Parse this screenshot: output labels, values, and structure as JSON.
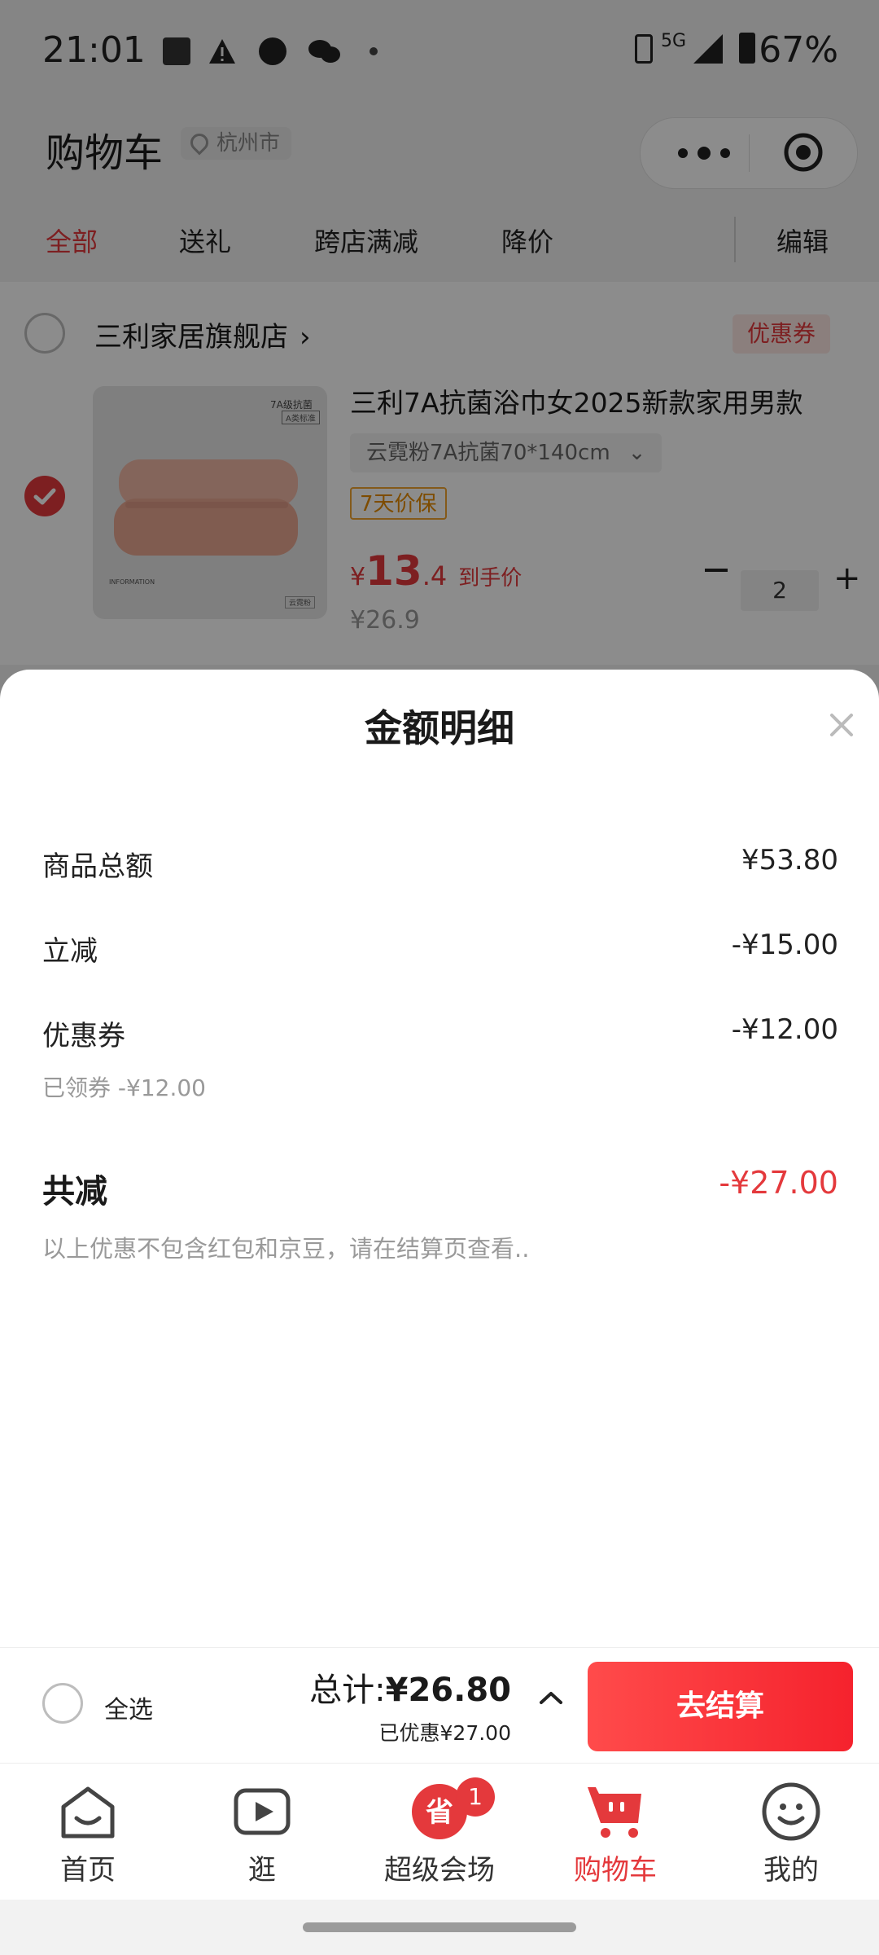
{
  "status_bar": {
    "time": "21:01",
    "battery": "67%",
    "network": "5G"
  },
  "header": {
    "title": "购物车",
    "location": "杭州市"
  },
  "tabs": [
    {
      "label": "全部",
      "active": true
    },
    {
      "label": "送礼"
    },
    {
      "label": "跨店满减"
    },
    {
      "label": "降价"
    },
    {
      "label": "编辑"
    }
  ],
  "store": {
    "name": "三利家居旗舰店",
    "coupon_label": "优惠券",
    "product": {
      "title": "三利7A抗菌浴巾女2025新款家用男款",
      "sku": "云霓粉7A抗菌70*140cm",
      "tag": "7天价保",
      "price_currency": "¥",
      "price_int": "13",
      "price_dec": ".4",
      "price_label": "到手价",
      "original_price": "¥26.9",
      "quantity": "2",
      "image_text_top": "7A级抗菌",
      "image_text_sub": "A类标准",
      "image_text_info": "INFORMATION",
      "image_text_tag": "云霓粉"
    }
  },
  "detail_sheet": {
    "title": "金额明细",
    "rows": [
      {
        "label": "商品总额",
        "value": "¥53.80"
      },
      {
        "label": "立减",
        "value": "-¥15.00"
      },
      {
        "label": "优惠券",
        "value": "-¥12.00"
      }
    ],
    "coupon_sub": "已领券 -¥12.00",
    "total_label": "共减",
    "total_value": "-¥27.00",
    "note": "以上优惠不包含红包和京豆，请在结算页查看.."
  },
  "checkout": {
    "select_all": "全选",
    "total_prefix": "总计:",
    "total_value": "¥26.80",
    "saved": "已优惠¥27.00",
    "pay_button": "去结算"
  },
  "nav": [
    {
      "label": "首页",
      "icon": "home-icon"
    },
    {
      "label": "逛",
      "icon": "video-icon"
    },
    {
      "label": "超级会场",
      "icon": "super-venue-icon"
    },
    {
      "label": "购物车",
      "icon": "cart-icon",
      "active": true
    },
    {
      "label": "我的",
      "icon": "profile-icon"
    }
  ],
  "nav_badge": "1",
  "colors": {
    "accent": "#e4393c",
    "warning": "#f0a430"
  }
}
